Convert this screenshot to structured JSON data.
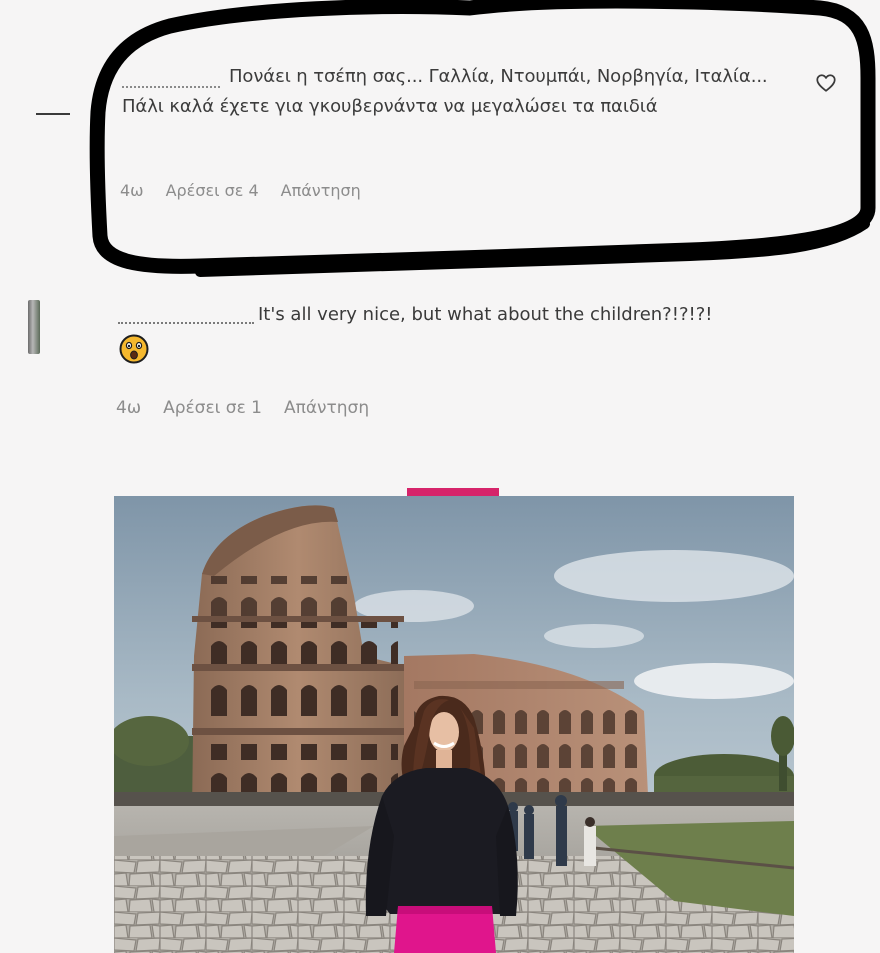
{
  "comments": [
    {
      "text": "Πονάει η τσέπη σας... Γαλλία, Ντουμπάι, Νορβηγία, Ιταλία... Πάλι καλά έχετε για γκουβερνάντα να μεγαλώσει τα παιδιά",
      "time": "4ω",
      "likes": "Αρέσει σε 4",
      "reply": "Απάντηση"
    },
    {
      "text": "It's all very nice, but what about the children?!?!?!",
      "time": "4ω",
      "likes": "Αρέσει σε 1",
      "reply": "Απάντηση"
    }
  ],
  "icons": {
    "like": "heart-outline-icon",
    "reaction": "astonished-face-emoji"
  },
  "colors": {
    "accent_tab": "#d6246a",
    "marker": "#000000",
    "meta_text": "#8c8c8c"
  }
}
